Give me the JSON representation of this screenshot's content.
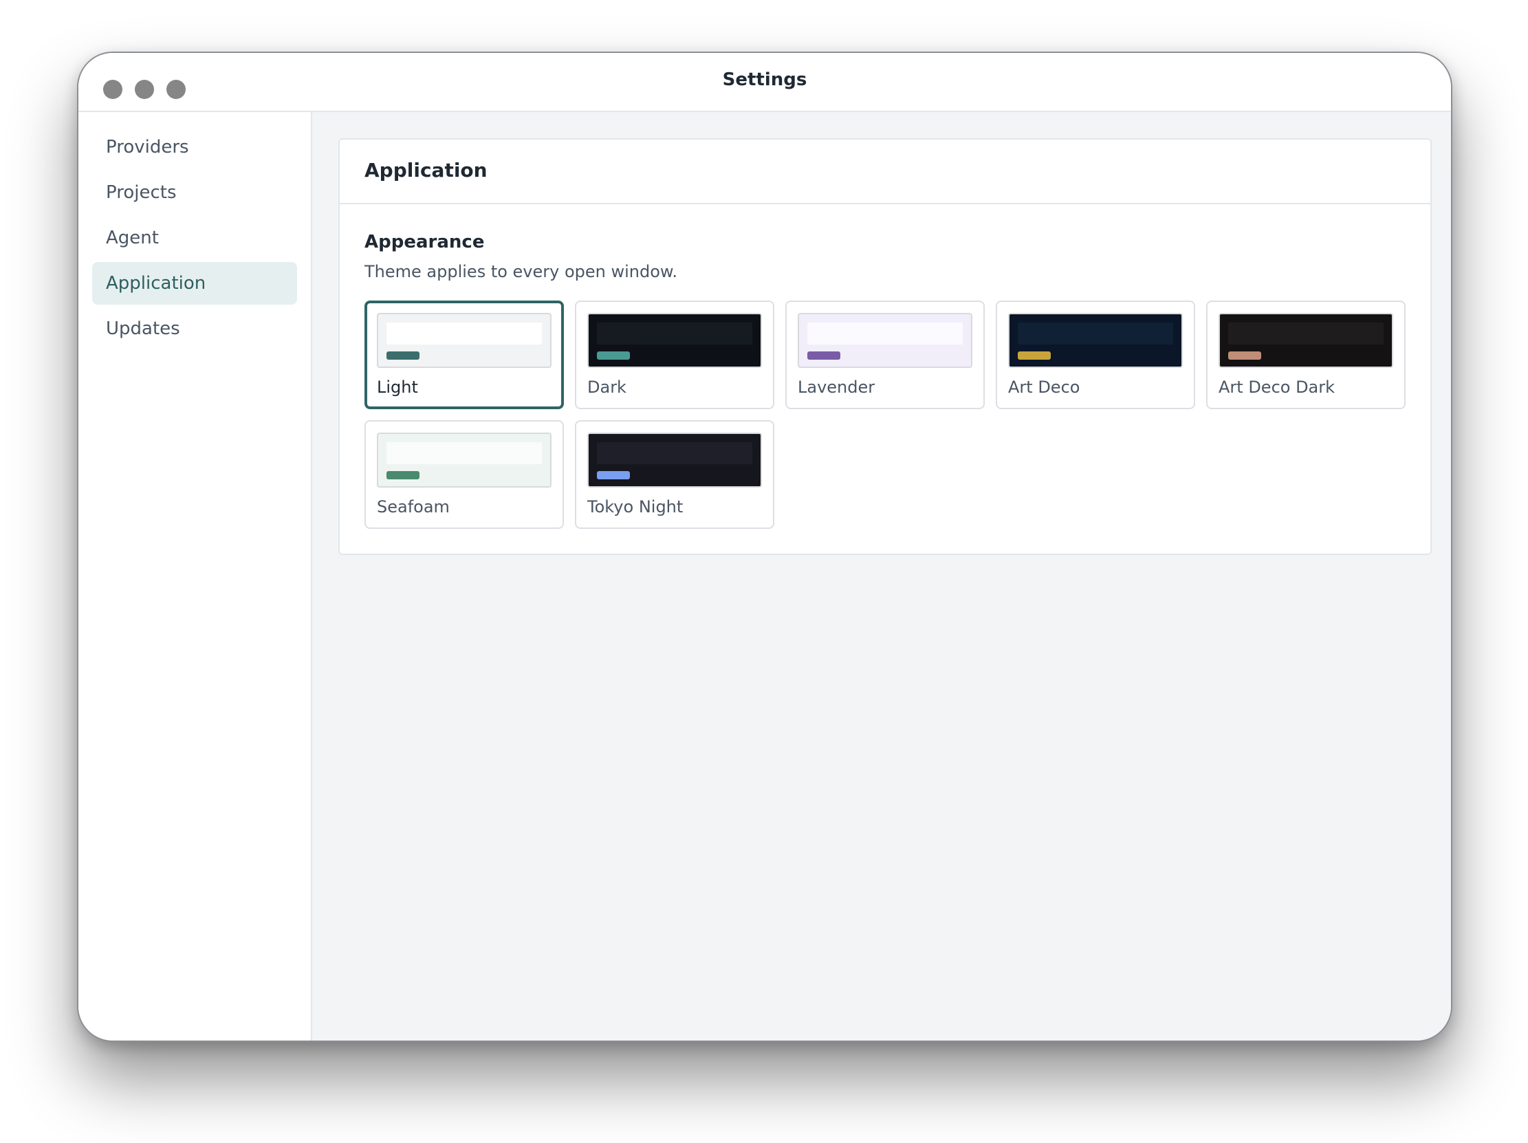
{
  "window": {
    "title": "Settings"
  },
  "sidebar": {
    "items": [
      {
        "label": "Providers"
      },
      {
        "label": "Projects"
      },
      {
        "label": "Agent"
      },
      {
        "label": "Application",
        "active": true
      },
      {
        "label": "Updates"
      }
    ]
  },
  "panel": {
    "title": "Application",
    "section_title": "Appearance",
    "section_desc": "Theme applies to every open window."
  },
  "themes": [
    {
      "label": "Light",
      "selected": true,
      "bg": "#f2f3f4",
      "bar": "#ffffff",
      "accent": "#3b6e6c"
    },
    {
      "label": "Dark",
      "bg": "#0d1117",
      "bar": "#161b22",
      "accent": "#4a9a93"
    },
    {
      "label": "Lavender",
      "bg": "#f1eefa",
      "bar": "#fbfaff",
      "accent": "#7a5ca6"
    },
    {
      "label": "Art Deco",
      "bg": "#0b1628",
      "bar": "#102035",
      "accent": "#c9a43d"
    },
    {
      "label": "Art Deco Dark",
      "bg": "#141213",
      "bar": "#1e1c1d",
      "accent": "#c08e76"
    },
    {
      "label": "Seafoam",
      "bg": "#eef4f1",
      "bar": "#f9fcfa",
      "accent": "#4a8a6e"
    },
    {
      "label": "Tokyo Night",
      "bg": "#16161e",
      "bar": "#1f1f2a",
      "accent": "#7a9ef2"
    }
  ]
}
